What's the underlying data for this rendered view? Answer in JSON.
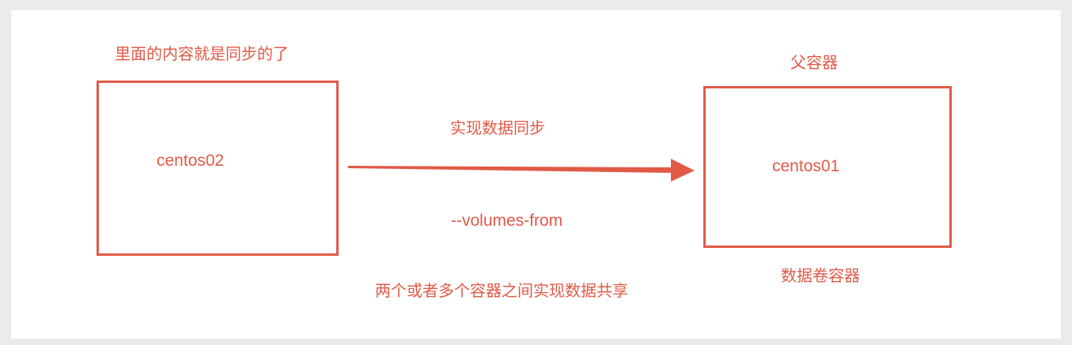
{
  "diagram": {
    "left_node": {
      "caption": "里面的内容就是同步的了",
      "label": "centos02"
    },
    "right_node": {
      "caption_top": "父容器",
      "label": "centos01",
      "caption_bottom": "数据卷容器"
    },
    "edge": {
      "label_top": "实现数据同步",
      "label_bottom": "--volumes-from"
    },
    "footer_note": "两个或者多个容器之间实现数据共享"
  },
  "colors": {
    "accent": "#e05a47",
    "background": "#ebebeb",
    "canvas": "#ffffff"
  }
}
